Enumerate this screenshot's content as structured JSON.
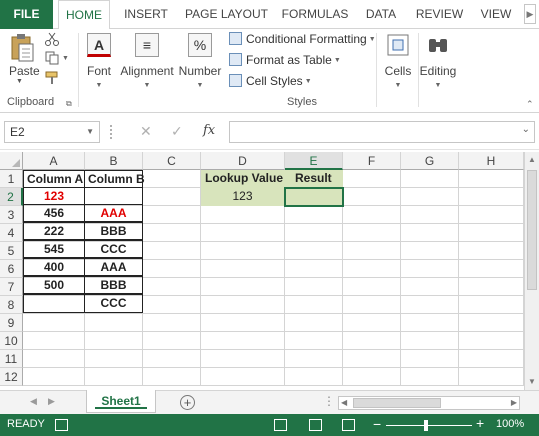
{
  "ribbon_tabs": {
    "file": "FILE",
    "home": "HOME",
    "insert": "INSERT",
    "page_layout": "PAGE LAYOUT",
    "formulas": "FORMULAS",
    "data": "DATA",
    "review": "REVIEW",
    "view": "VIEW"
  },
  "ribbon": {
    "clipboard": {
      "paste": "Paste",
      "group_label": "Clipboard"
    },
    "font": {
      "label": "Font",
      "icon_glyph": "A"
    },
    "alignment": {
      "label": "Alignment",
      "icon_glyph": "≡"
    },
    "number": {
      "label": "Number",
      "icon_glyph": "%"
    },
    "styles": {
      "conditional_formatting": "Conditional Formatting",
      "format_as_table": "Format as Table",
      "cell_styles": "Cell Styles",
      "group_label": "Styles"
    },
    "cells": {
      "label": "Cells"
    },
    "editing": {
      "label": "Editing"
    }
  },
  "formula_bar": {
    "name_box": "E2",
    "cancel_glyph": "✕",
    "enter_glyph": "✓",
    "fx_label": "fx",
    "formula": ""
  },
  "sheet": {
    "columns": [
      "A",
      "B",
      "C",
      "D",
      "E",
      "F",
      "G",
      "H"
    ],
    "rows": [
      "1",
      "2",
      "3",
      "4",
      "5",
      "6",
      "7",
      "8",
      "9",
      "10",
      "11",
      "12"
    ],
    "cells": {
      "A1": "Column A",
      "B1": "Column B",
      "A2": "123",
      "B2": "",
      "A3": "456",
      "B3": "AAA",
      "A4": "222",
      "B4": "BBB",
      "A5": "545",
      "B5": "CCC",
      "A6": "400",
      "B6": "AAA",
      "A7": "500",
      "B7": "BBB",
      "A8": "",
      "B8": "CCC",
      "D1": "Lookup Value",
      "E1": "Result",
      "D2": "123",
      "E2": ""
    },
    "selected_cell": "E2"
  },
  "sheet_tabs": {
    "active": "Sheet1",
    "add_glyph": "+"
  },
  "status_bar": {
    "mode": "READY",
    "zoom": "100%",
    "zoom_minus": "−",
    "zoom_plus": "+"
  },
  "colors": {
    "accent_green": "#217346",
    "highlight_fill": "#d8e4bc",
    "red_text": "#e10000"
  }
}
